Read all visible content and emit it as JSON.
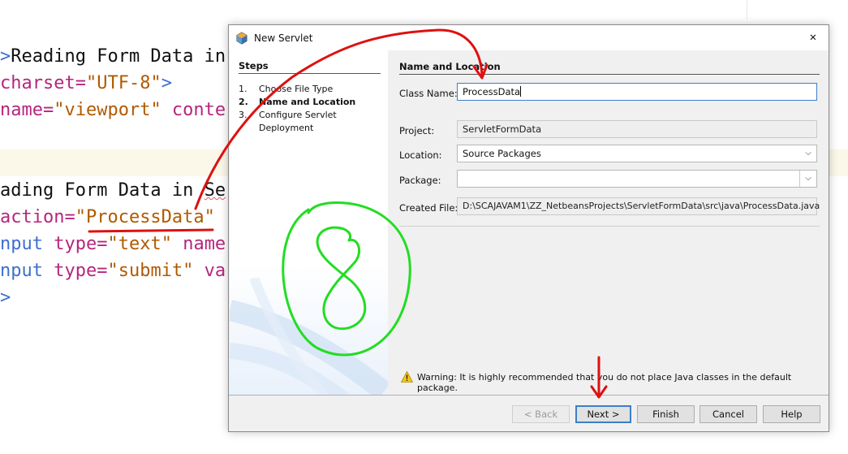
{
  "editor": {
    "lines": [
      {
        "parts": [
          {
            "t": ">",
            "c": "tag"
          },
          {
            "t": "Reading Form Data in",
            "c": "text"
          }
        ]
      },
      {
        "parts": [
          {
            "t": "charset=",
            "c": "attr"
          },
          {
            "t": "\"UTF-8\"",
            "c": "str"
          },
          {
            "t": ">",
            "c": "tag"
          }
        ]
      },
      {
        "parts": [
          {
            "t": "name=",
            "c": "attr"
          },
          {
            "t": "\"viewport\"",
            "c": "str"
          },
          {
            "t": " conte",
            "c": "attr"
          }
        ]
      },
      {
        "parts": [
          {
            "t": "ading Form Data in ",
            "c": "text"
          },
          {
            "t": "Se",
            "c": "text squig"
          }
        ]
      },
      {
        "parts": [
          {
            "t": "action=",
            "c": "attr"
          },
          {
            "t": "\"ProcessData\"",
            "c": "str"
          }
        ]
      },
      {
        "parts": [
          {
            "t": "nput",
            "c": "tag"
          },
          {
            "t": " type=",
            "c": "attr"
          },
          {
            "t": "\"text\"",
            "c": "str"
          },
          {
            "t": " name",
            "c": "attr"
          }
        ]
      },
      {
        "parts": [
          {
            "t": "nput",
            "c": "tag"
          },
          {
            "t": " type=",
            "c": "attr"
          },
          {
            "t": "\"submit\"",
            "c": "str"
          },
          {
            "t": " va",
            "c": "attr"
          }
        ]
      },
      {
        "parts": [
          {
            "t": ">",
            "c": "tag"
          }
        ]
      }
    ]
  },
  "dialog": {
    "title": "New Servlet",
    "close_glyph": "✕",
    "steps": {
      "heading": "Steps",
      "items": [
        {
          "num": "1.",
          "label": "Choose File Type"
        },
        {
          "num": "2.",
          "label": "Name and Location"
        },
        {
          "num": "3.",
          "label": "Configure Servlet Deployment"
        }
      ],
      "current_index": 1
    },
    "content": {
      "heading": "Name and Location",
      "class_name": {
        "label": "Class Name:",
        "value": "ProcessData"
      },
      "project": {
        "label": "Project:",
        "value": "ServletFormData"
      },
      "location": {
        "label": "Location:",
        "value": "Source Packages"
      },
      "package": {
        "label": "Package:",
        "value": ""
      },
      "created_file": {
        "label": "Created File:",
        "value": "D:\\SCAJAVAM1\\ZZ_NetbeansProjects\\ServletFormData\\src\\java\\ProcessData.java"
      }
    },
    "warning": "Warning: It is highly recommended that you do not place Java classes in the default package.",
    "buttons": {
      "back": "< Back",
      "next": "Next >",
      "finish": "Finish",
      "cancel": "Cancel",
      "help": "Help"
    }
  },
  "annotations": {
    "handwritten_number": "8",
    "number_color": "#22dd22",
    "arrow_color": "#dd1111"
  }
}
